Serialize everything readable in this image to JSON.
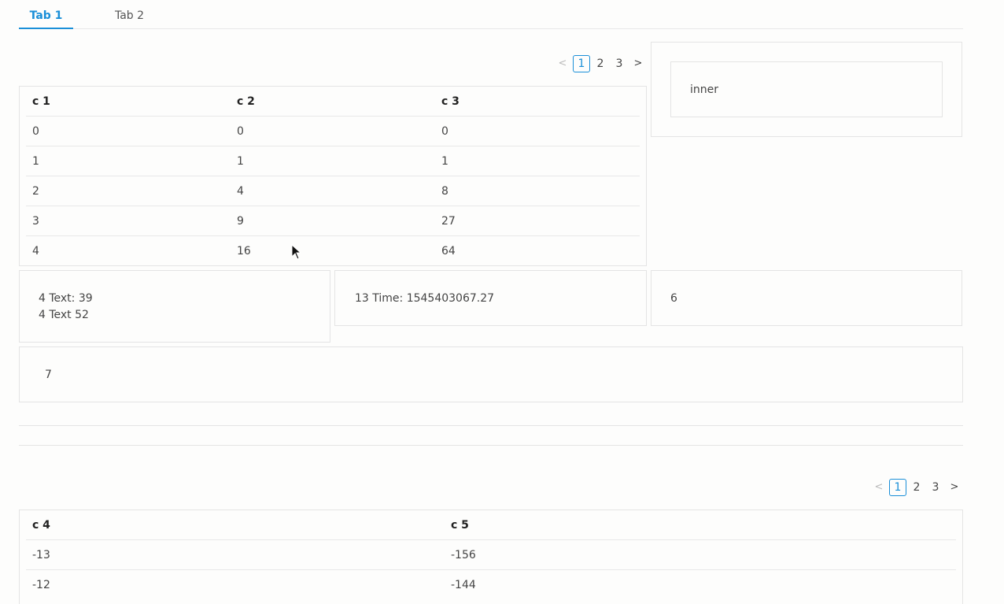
{
  "tabs": [
    {
      "label": "Tab 1",
      "active": true
    },
    {
      "label": "Tab 2",
      "active": false
    }
  ],
  "pager_top": {
    "prev": "<",
    "pages": [
      "1",
      "2",
      "3"
    ],
    "next": ">"
  },
  "table1": {
    "headers": [
      "c 1",
      "c 2",
      "c 3"
    ],
    "rows": [
      [
        "0",
        "0",
        "0"
      ],
      [
        "1",
        "1",
        "1"
      ],
      [
        "2",
        "4",
        "8"
      ],
      [
        "3",
        "9",
        "27"
      ],
      [
        "4",
        "16",
        "64"
      ]
    ]
  },
  "inner_panel": {
    "text": "inner"
  },
  "cards": {
    "text_card": {
      "line1": "4 Text: 39",
      "line2": "4 Text 52"
    },
    "time_card": {
      "text": "13 Time: 1545403067.27"
    },
    "six_card": {
      "text": "6"
    },
    "seven_card": {
      "text": "7"
    }
  },
  "pager_bottom": {
    "prev": "<",
    "pages": [
      "1",
      "2",
      "3"
    ],
    "next": ">"
  },
  "table2": {
    "headers": [
      "c 4",
      "c 5"
    ],
    "rows": [
      [
        "-13",
        "-156"
      ],
      [
        "-12",
        "-144"
      ]
    ]
  },
  "colors": {
    "accent": "#1a8fd8",
    "border": "#e4e4e4"
  }
}
